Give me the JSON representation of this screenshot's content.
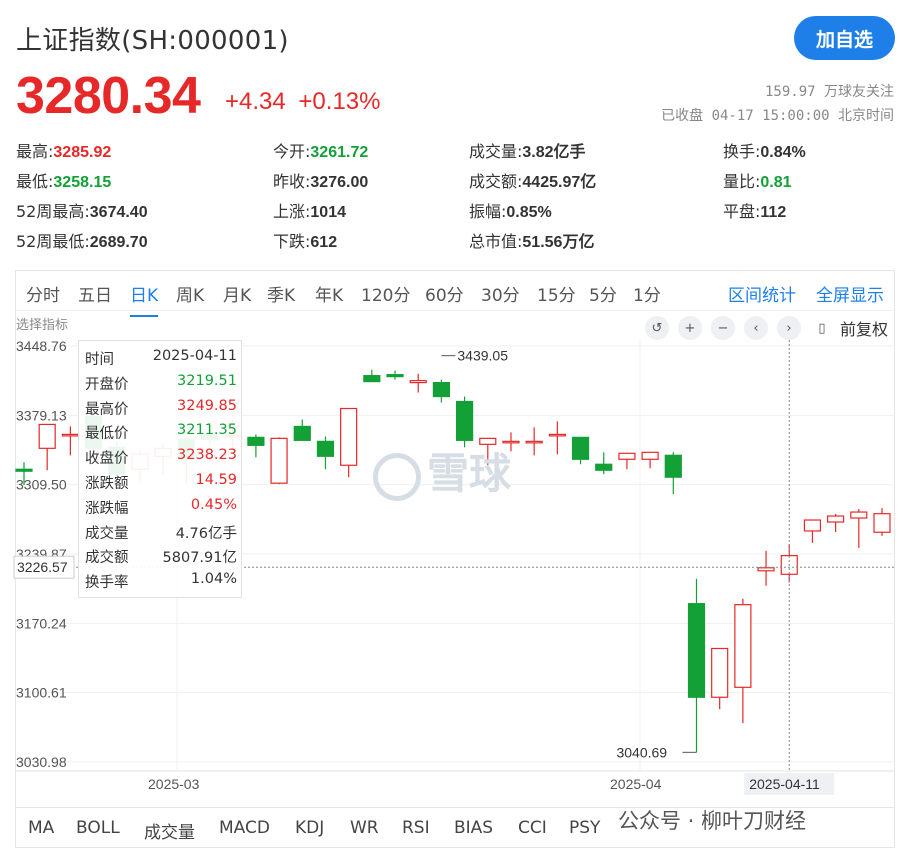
{
  "header": {
    "title": "上证指数(SH:000001)",
    "follow_label": "加自选",
    "price": "3280.34",
    "change": "+4.34",
    "change_pct": "+0.13%",
    "followers": "159.97 万球友关注",
    "status": "已收盘 04-17 15:00:00 北京时间"
  },
  "stats": [
    {
      "label": "最高:",
      "value": "3285.92",
      "color": "red"
    },
    {
      "label": "今开:",
      "value": "3261.72",
      "color": "green"
    },
    {
      "label": "成交量:",
      "value": "3.82亿手",
      "color": "normal"
    },
    {
      "label": "换手:",
      "value": "0.84%",
      "color": "normal"
    },
    {
      "label": "最低:",
      "value": "3258.15",
      "color": "green"
    },
    {
      "label": "昨收:",
      "value": "3276.00",
      "color": "normal"
    },
    {
      "label": "成交额:",
      "value": "4425.97亿",
      "color": "normal"
    },
    {
      "label": "量比:",
      "value": "0.81",
      "color": "green"
    },
    {
      "label": "52周最高:",
      "value": "3674.40",
      "color": "normal"
    },
    {
      "label": "上涨:",
      "value": "1014",
      "color": "normal"
    },
    {
      "label": "振幅:",
      "value": "0.85%",
      "color": "normal"
    },
    {
      "label": "平盘:",
      "value": "112",
      "color": "normal"
    },
    {
      "label": "52周最低:",
      "value": "2689.70",
      "color": "normal"
    },
    {
      "label": "下跌:",
      "value": "612",
      "color": "normal"
    },
    {
      "label": "总市值:",
      "value": "51.56万亿",
      "color": "normal"
    }
  ],
  "period_tabs": [
    "分时",
    "五日",
    "日K",
    "周K",
    "月K",
    "季K",
    "年K",
    "120分",
    "60分",
    "30分",
    "15分",
    "5分",
    "1分"
  ],
  "active_tab": "日K",
  "links": {
    "range_stats": "区间统计",
    "fullscreen": "全屏显示"
  },
  "indicator_label": "选择指标",
  "adjust_label": "前复权",
  "bottom_tabs": [
    "MA",
    "BOLL",
    "成交量",
    "MACD",
    "KDJ",
    "WR",
    "RSI",
    "BIAS",
    "CCI",
    "PSY"
  ],
  "tooltip": [
    {
      "label": "时间",
      "value": "2025-04-11",
      "color": "normal"
    },
    {
      "label": "开盘价",
      "value": "3219.51",
      "color": "green"
    },
    {
      "label": "最高价",
      "value": "3249.85",
      "color": "red"
    },
    {
      "label": "最低价",
      "value": "3211.35",
      "color": "green"
    },
    {
      "label": "收盘价",
      "value": "3238.23",
      "color": "red"
    },
    {
      "label": "涨跌额",
      "value": "14.59",
      "color": "red"
    },
    {
      "label": "涨跌幅",
      "value": "0.45%",
      "color": "red"
    },
    {
      "label": "成交量",
      "value": "4.76亿手",
      "color": "normal"
    },
    {
      "label": "成交额",
      "value": "5807.91亿",
      "color": "normal"
    },
    {
      "label": "换手率",
      "value": "1.04%",
      "color": "normal"
    }
  ],
  "watermark": "雪球",
  "footer_watermark": "公众号 · 柳叶刀财经",
  "colors": {
    "up": "#e62828",
    "down": "#13a037",
    "accent": "#1f7fe8"
  },
  "chart_data": {
    "type": "candlestick",
    "y_ticks": [
      "3448.76",
      "3379.13",
      "3309.50",
      "3239.87",
      "3170.24",
      "3100.61",
      "3030.98"
    ],
    "ylim": [
      3030.98,
      3448.76
    ],
    "x_ticks": [
      "2025-03",
      "2025-04"
    ],
    "crosshair": {
      "price": "3226.57",
      "date": "2025-04-11"
    },
    "annotations": {
      "high": "3439.05",
      "low": "3040.69"
    },
    "candles": [
      {
        "o": 3325,
        "h": 3332,
        "l": 3309,
        "c": 3323
      },
      {
        "o": 3346,
        "h": 3368,
        "l": 3324,
        "c": 3370
      },
      {
        "o": 3359,
        "h": 3368,
        "l": 3339,
        "c": 3360
      },
      {
        "o": 3378,
        "h": 3380,
        "l": 3340,
        "c": 3346
      },
      {
        "o": 3347,
        "h": 3353,
        "l": 3318,
        "c": 3320
      },
      {
        "o": 3325,
        "h": 3345,
        "l": 3313,
        "c": 3340
      },
      {
        "o": 3338,
        "h": 3350,
        "l": 3320,
        "c": 3346
      },
      {
        "o": 3355,
        "h": 3358,
        "l": 3310,
        "c": 3335
      },
      {
        "o": 3360,
        "h": 3362,
        "l": 3350,
        "c": 3355
      },
      {
        "o": 3359,
        "h": 3375,
        "l": 3345,
        "c": 3359
      },
      {
        "o": 3357,
        "h": 3360,
        "l": 3337,
        "c": 3349
      },
      {
        "o": 3311,
        "h": 3357,
        "l": 3310,
        "c": 3356
      },
      {
        "o": 3368,
        "h": 3375,
        "l": 3357,
        "c": 3354
      },
      {
        "o": 3353,
        "h": 3358,
        "l": 3325,
        "c": 3338
      },
      {
        "o": 3329,
        "h": 3362,
        "l": 3317,
        "c": 3386
      },
      {
        "o": 3419,
        "h": 3425,
        "l": 3413,
        "c": 3413
      },
      {
        "o": 3420,
        "h": 3424,
        "l": 3415,
        "c": 3418
      },
      {
        "o": 3412,
        "h": 3421,
        "l": 3402,
        "c": 3414
      },
      {
        "o": 3412,
        "h": 3415,
        "l": 3392,
        "c": 3398
      },
      {
        "o": 3393,
        "h": 3398,
        "l": 3347,
        "c": 3354
      },
      {
        "o": 3350,
        "h": 3356,
        "l": 3329,
        "c": 3356
      },
      {
        "o": 3353,
        "h": 3362,
        "l": 3343,
        "c": 3353
      },
      {
        "o": 3352,
        "h": 3367,
        "l": 3339,
        "c": 3353
      },
      {
        "o": 3359,
        "h": 3373,
        "l": 3340,
        "c": 3360
      },
      {
        "o": 3357,
        "h": 3357,
        "l": 3330,
        "c": 3335
      },
      {
        "o": 3330,
        "h": 3342,
        "l": 3320,
        "c": 3324
      },
      {
        "o": 3335,
        "h": 3340,
        "l": 3325,
        "c": 3341
      },
      {
        "o": 3335,
        "h": 3342,
        "l": 3326,
        "c": 3342
      },
      {
        "o": 3339,
        "h": 3342,
        "l": 3300,
        "c": 3317
      },
      {
        "o": 3190,
        "h": 3215,
        "l": 3040.69,
        "c": 3096
      },
      {
        "o": 3096,
        "h": 3144,
        "l": 3084,
        "c": 3145
      },
      {
        "o": 3106,
        "h": 3195,
        "l": 3070,
        "c": 3189
      },
      {
        "o": 3223,
        "h": 3243,
        "l": 3208,
        "c": 3226
      },
      {
        "o": 3219.51,
        "h": 3249.85,
        "l": 3211.35,
        "c": 3238.23
      },
      {
        "o": 3263,
        "h": 3272,
        "l": 3251,
        "c": 3274
      },
      {
        "o": 3272,
        "h": 3280,
        "l": 3262,
        "c": 3278
      },
      {
        "o": 3276,
        "h": 3285,
        "l": 3246,
        "c": 3282
      },
      {
        "o": 3261.72,
        "h": 3285.92,
        "l": 3258.15,
        "c": 3280.34
      }
    ]
  }
}
